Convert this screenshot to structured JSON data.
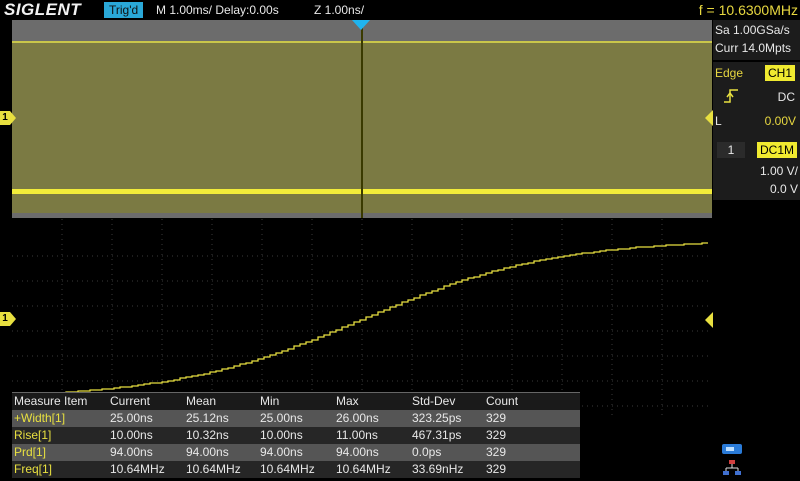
{
  "header": {
    "brand": "SIGLENT",
    "trig_status": "Trig'd",
    "timebase": "M 1.00ms/ Delay:0.00s",
    "zoom_timebase": "Z 1.00ns/",
    "frequency": "f = 10.6300MHz"
  },
  "acquisition": {
    "sample_rate": "Sa 1.00GSa/s",
    "memory_depth": "Curr 14.0Mpts"
  },
  "trigger": {
    "type": "Edge",
    "source": "CH1",
    "coupling": "DC",
    "level_label": "L",
    "level": "0.00V"
  },
  "channel1": {
    "number": "1",
    "impedance": "DC1M",
    "scale": "1.00 V/",
    "offset": "0.0 V",
    "marker_label": "1"
  },
  "measure": {
    "headers": [
      "Measure Item",
      "Current",
      "Mean",
      "Min",
      "Max",
      "Std-Dev",
      "Count"
    ],
    "rows": [
      {
        "item": "+Width[1]",
        "current": "25.00ns",
        "mean": "25.12ns",
        "min": "25.00ns",
        "max": "26.00ns",
        "stddev": "323.25ps",
        "count": "329"
      },
      {
        "item": "Rise[1]",
        "current": "10.00ns",
        "mean": "10.32ns",
        "min": "10.00ns",
        "max": "11.00ns",
        "stddev": "467.31ps",
        "count": "329"
      },
      {
        "item": "Prd[1]",
        "current": "94.00ns",
        "mean": "94.00ns",
        "min": "94.00ns",
        "max": "94.00ns",
        "stddev": "0.0ps",
        "count": "329"
      },
      {
        "item": "Freq[1]",
        "current": "10.64MHz",
        "mean": "10.64MHz",
        "min": "10.64MHz",
        "max": "10.64MHz",
        "stddev": "33.69nHz",
        "count": "329"
      }
    ]
  },
  "colors": {
    "trace": "#e8e040",
    "marker": "#1fb4ef",
    "trig_badge": "#2aa8d8"
  },
  "icons": {
    "edge_icon": "rising-edge-icon",
    "status_icons": [
      "usb-icon",
      "network-icon"
    ]
  }
}
